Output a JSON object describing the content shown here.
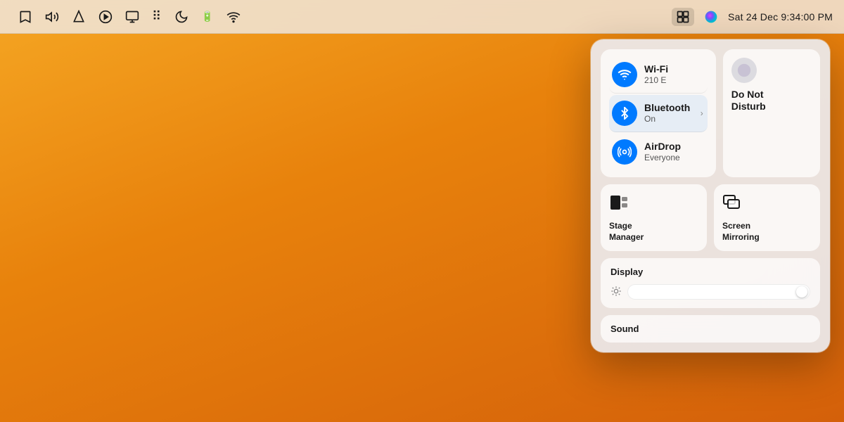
{
  "menubar": {
    "clock": "Sat 24 Dec  9:34:00 PM",
    "icons": [
      {
        "name": "bookmark-icon",
        "symbol": "🔖"
      },
      {
        "name": "volume-icon",
        "symbol": "🔊"
      },
      {
        "name": "airdrop-menu-icon",
        "symbol": "▲"
      },
      {
        "name": "play-icon",
        "symbol": "▶"
      },
      {
        "name": "display-menu-icon",
        "symbol": "🖥"
      },
      {
        "name": "dots-icon",
        "symbol": "·:·"
      },
      {
        "name": "moon-icon",
        "symbol": "☽"
      },
      {
        "name": "battery-icon",
        "symbol": "🔋"
      },
      {
        "name": "wifi-menu-icon",
        "symbol": "📶"
      },
      {
        "name": "control-center-icon",
        "symbol": "⊞"
      },
      {
        "name": "siri-icon",
        "symbol": "◉"
      }
    ]
  },
  "control_center": {
    "connectivity": {
      "wifi": {
        "title": "Wi-Fi",
        "subtitle": "210 E",
        "active": true
      },
      "bluetooth": {
        "title": "Bluetooth",
        "subtitle": "On",
        "active": true,
        "has_chevron": true,
        "chevron": "›"
      },
      "airdrop": {
        "title": "AirDrop",
        "subtitle": "Everyone",
        "active": true
      }
    },
    "do_not_disturb": {
      "label": "Do Not\nDisturb",
      "label_line1": "Do Not",
      "label_line2": "Disturb"
    },
    "stage_manager": {
      "label": "Stage\nManager",
      "label_line1": "Stage",
      "label_line2": "Manager"
    },
    "screen_mirroring": {
      "label": "Screen\nMirroring",
      "label_line1": "Screen",
      "label_line2": "Mirroring"
    },
    "display": {
      "header": "Display",
      "brightness_value": 95
    },
    "sound": {
      "header": "Sound"
    }
  },
  "colors": {
    "blue_active": "#007AFF",
    "panel_bg": "rgba(235,235,240,0.92)",
    "item_bg": "rgba(255,255,255,0.7)"
  }
}
